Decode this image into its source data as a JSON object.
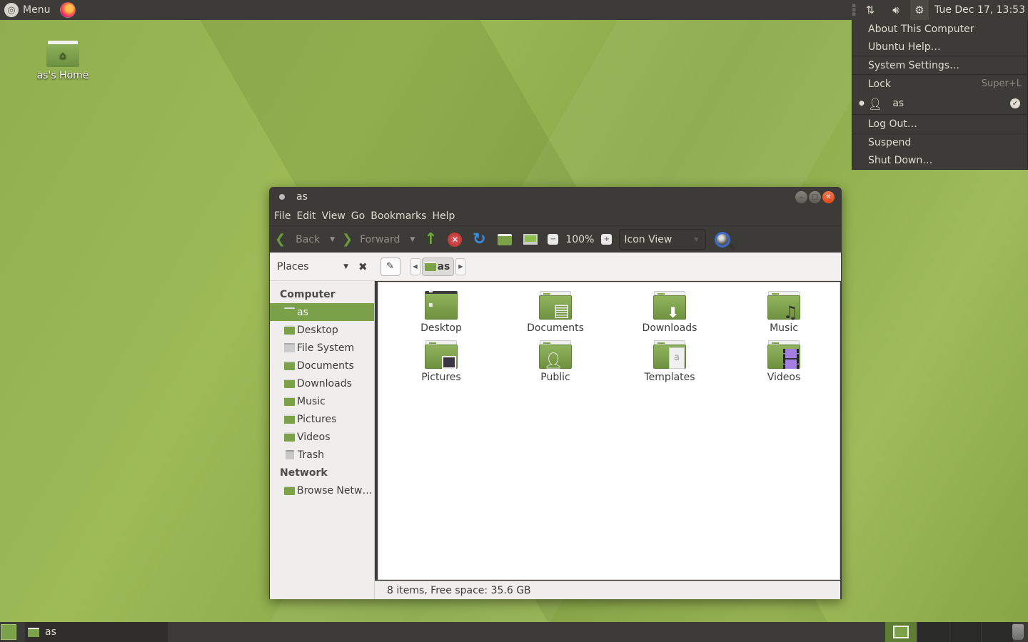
{
  "top_panel": {
    "menu_label": "Menu",
    "firefox_icon": "firefox-icon",
    "clock": "Tue Dec 17, 13:53"
  },
  "session_menu": {
    "items": [
      {
        "label": "About This Computer"
      },
      {
        "label": "Ubuntu Help…"
      },
      {
        "label": "System Settings…"
      },
      {
        "label": "Lock",
        "accel": "Super+L"
      },
      {
        "label": "as"
      },
      {
        "label": "Log Out…"
      },
      {
        "label": "Suspend"
      },
      {
        "label": "Shut Down…"
      }
    ]
  },
  "desktop": {
    "home_label": "as's Home"
  },
  "window": {
    "title": "as",
    "menus": [
      "File",
      "Edit",
      "View",
      "Go",
      "Bookmarks",
      "Help"
    ],
    "toolbar": {
      "back": "Back",
      "forward": "Forward",
      "zoom": "100%",
      "view_mode": "Icon View"
    },
    "location": {
      "pane_selector": "Places",
      "crumb": "as"
    },
    "sidebar": {
      "computer_header": "Computer",
      "computer_items": [
        "as",
        "Desktop",
        "File System",
        "Documents",
        "Downloads",
        "Music",
        "Pictures",
        "Videos",
        "Trash"
      ],
      "selected": "as",
      "network_header": "Network",
      "network_items": [
        "Browse Netw…"
      ]
    },
    "files": [
      "Desktop",
      "Documents",
      "Downloads",
      "Music",
      "Pictures",
      "Public",
      "Templates",
      "Videos"
    ],
    "status": "8 items, Free space: 35.6 GB"
  },
  "taskbar": {
    "task_label": "as"
  },
  "colors": {
    "panel": "#3c3b37",
    "accent": "#7aa04a",
    "close": "#df4a17"
  }
}
